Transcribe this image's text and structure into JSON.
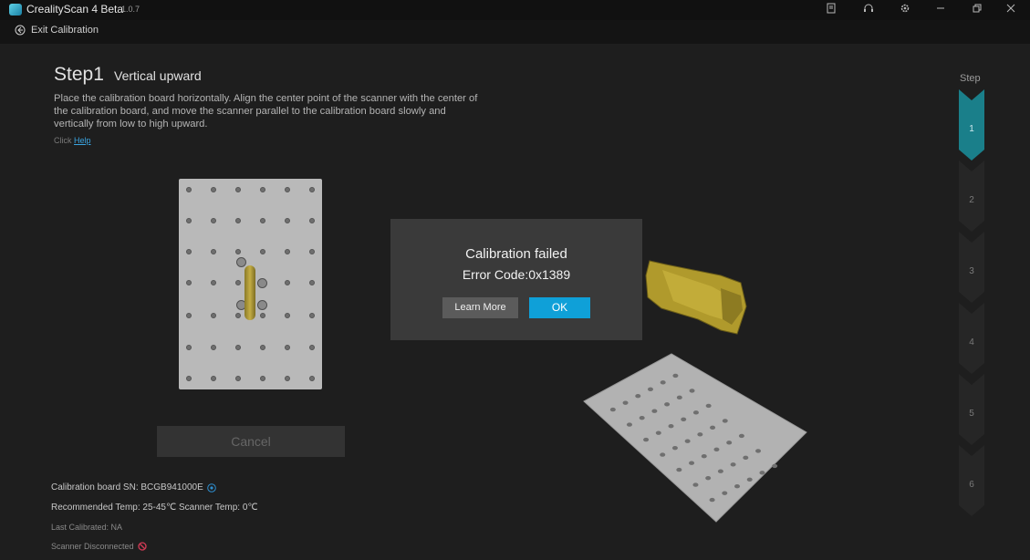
{
  "app": {
    "title": "CrealityScan 4 Beta",
    "version": "1.0.7"
  },
  "exit_label": "Exit Calibration",
  "step": {
    "number": "Step1",
    "title": "Vertical upward"
  },
  "instructions": "Place the calibration board horizontally. Align the center point of the scanner with the center of the calibration board, and move the scanner parallel to the calibration board slowly and vertically from low to high upward.",
  "help": {
    "prefix": "Click",
    "link": "Help"
  },
  "cancel_label": "Cancel",
  "info": {
    "board_sn": "Calibration board SN: BCGB941000E",
    "temp": "Recommended Temp: 25-45℃ Scanner Temp: 0℃",
    "last_calibrated": "Last Calibrated: NA",
    "scanner_status": "Scanner Disconnected"
  },
  "dialog": {
    "title": "Calibration failed",
    "error": "Error Code:0x1389",
    "learn_more": "Learn More",
    "ok": "OK"
  },
  "step_rail": {
    "label": "Step",
    "steps": [
      "1",
      "2",
      "3",
      "4",
      "5",
      "6"
    ],
    "active_index": 0
  },
  "colors": {
    "accent": "#0fa0d8",
    "active_step": "#1a7f8a",
    "background": "#1e1e1e"
  },
  "icons": [
    "app-logo-icon",
    "notes-icon",
    "headset-icon",
    "gear-icon",
    "minimize-icon",
    "restore-icon",
    "close-icon",
    "exit-arrow-icon",
    "info-icon",
    "disconnected-icon"
  ]
}
